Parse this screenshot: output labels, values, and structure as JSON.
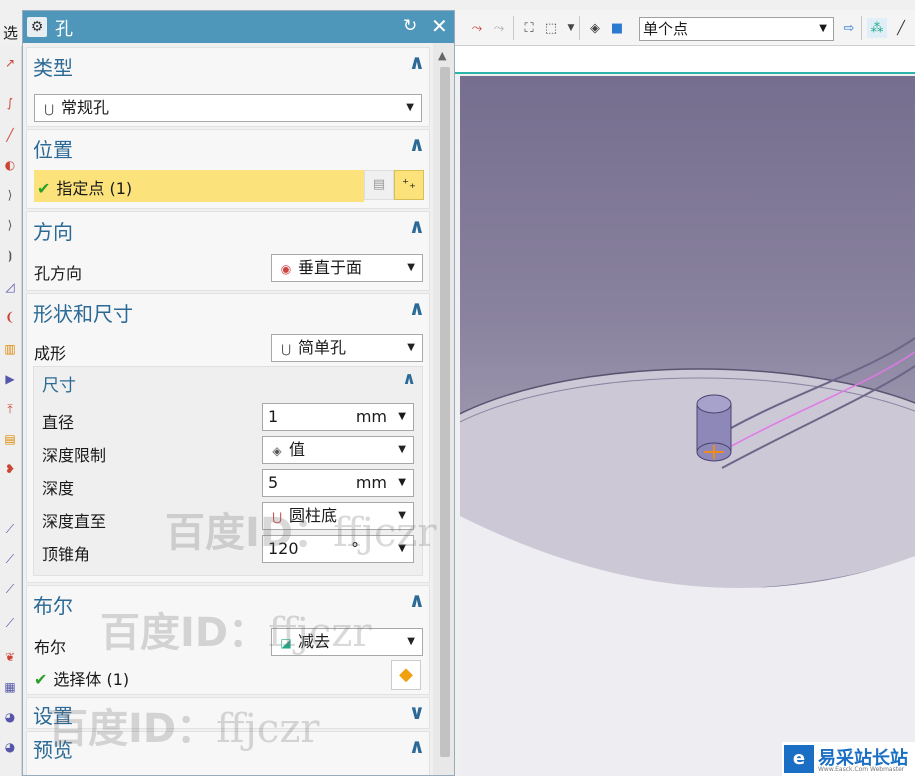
{
  "toolbar": {
    "left_text": "选",
    "selection_filter": "单个点"
  },
  "dialog": {
    "title": "孔",
    "groups": {
      "type": {
        "header": "类型",
        "dropdown": "常规孔"
      },
      "position": {
        "header": "位置",
        "specify_point": "指定点 (1)"
      },
      "direction": {
        "header": "方向",
        "label": "孔方向",
        "dropdown": "垂直于面"
      },
      "shape": {
        "header": "形状和尺寸",
        "form_label": "成形",
        "form_value": "简单孔",
        "size": {
          "header": "尺寸",
          "diameter_label": "直径",
          "diameter_value": "1",
          "diameter_unit": "mm",
          "depth_limit_label": "深度限制",
          "depth_limit_value": "值",
          "depth_label": "深度",
          "depth_value": "5",
          "depth_unit": "mm",
          "depth_to_label": "深度直至",
          "depth_to_value": "圆柱底",
          "tip_angle_label": "顶锥角",
          "tip_angle_value": "120",
          "tip_angle_unit": "°"
        }
      },
      "boolean": {
        "header": "布尔",
        "label": "布尔",
        "dropdown": "减去",
        "select_body": "选择体 (1)"
      },
      "settings": {
        "header": "设置"
      },
      "preview": {
        "header": "预览"
      }
    }
  },
  "watermarks": {
    "text_cn": "百度ID：",
    "text_en": "ffjczr"
  },
  "logo": {
    "name": "易采站长站",
    "sub": "Www.Easck.Com Webmaster"
  },
  "colors": {
    "title_bar": "#4f96bb",
    "header_text": "#2b6a96",
    "highlight": "#fbe27a",
    "check": "#2aa02a"
  }
}
